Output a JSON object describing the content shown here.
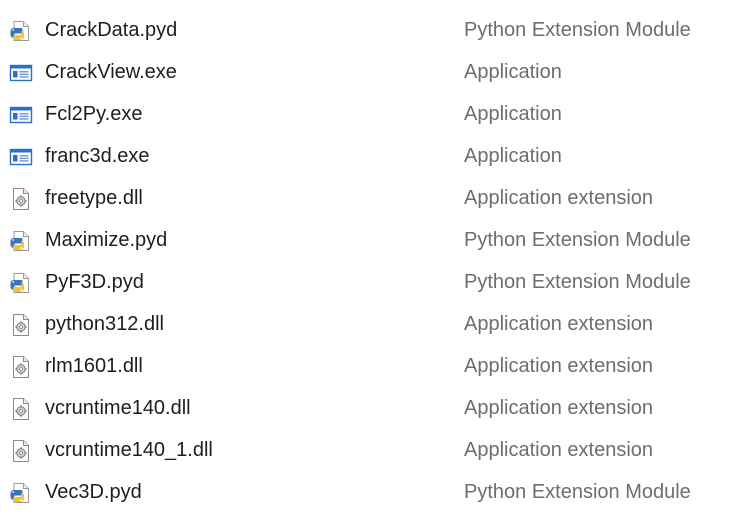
{
  "files": [
    {
      "name": "CrackData.pyd",
      "type": "Python Extension Module",
      "icon": "python-file-icon"
    },
    {
      "name": "CrackView.exe",
      "type": "Application",
      "icon": "application-icon"
    },
    {
      "name": "Fcl2Py.exe",
      "type": "Application",
      "icon": "application-icon"
    },
    {
      "name": "franc3d.exe",
      "type": "Application",
      "icon": "application-icon"
    },
    {
      "name": "freetype.dll",
      "type": "Application extension",
      "icon": "dll-file-icon"
    },
    {
      "name": "Maximize.pyd",
      "type": "Python Extension Module",
      "icon": "python-file-icon"
    },
    {
      "name": "PyF3D.pyd",
      "type": "Python Extension Module",
      "icon": "python-file-icon"
    },
    {
      "name": "python312.dll",
      "type": "Application extension",
      "icon": "dll-file-icon"
    },
    {
      "name": "rlm1601.dll",
      "type": "Application extension",
      "icon": "dll-file-icon"
    },
    {
      "name": "vcruntime140.dll",
      "type": "Application extension",
      "icon": "dll-file-icon"
    },
    {
      "name": "vcruntime140_1.dll",
      "type": "Application extension",
      "icon": "dll-file-icon"
    },
    {
      "name": "Vec3D.pyd",
      "type": "Python Extension Module",
      "icon": "python-file-icon"
    }
  ],
  "colors": {
    "name_text": "#1e1e1e",
    "type_text": "#6d6d6d",
    "python_blue": "#3b74b8",
    "python_yellow": "#f5c331",
    "app_blue": "#2a6fc9"
  }
}
